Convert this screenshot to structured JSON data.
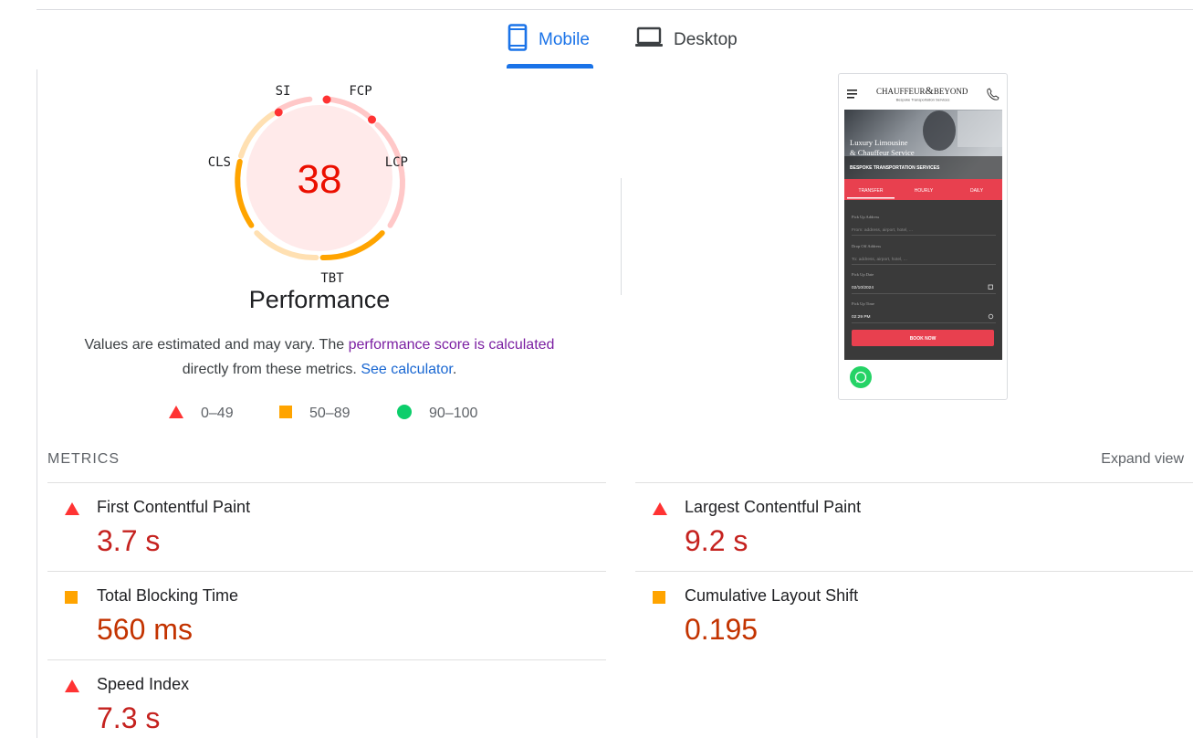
{
  "tabs": [
    {
      "label": "Mobile",
      "active": true
    },
    {
      "label": "Desktop",
      "active": false
    }
  ],
  "gauge": {
    "score": "38",
    "labels": {
      "si": "SI",
      "fcp": "FCP",
      "lcp": "LCP",
      "tbt": "TBT",
      "cls": "CLS"
    },
    "title": "Performance",
    "colors": {
      "fail": "#ff3333",
      "average": "#ffa400",
      "pass": "#0cce6b",
      "score_text": "#eb0f00",
      "fill": "#ffeaea"
    }
  },
  "description": {
    "part1": "Values are estimated and may vary. The ",
    "link1": "performance score is calculated",
    "part2": "directly from these metrics. ",
    "link2": "See calculator",
    "part3": "."
  },
  "legend": [
    {
      "range": "0–49",
      "icon": "triangle-icon"
    },
    {
      "range": "50–89",
      "icon": "square-icon"
    },
    {
      "range": "90–100",
      "icon": "circle-icon"
    }
  ],
  "screenshot": {
    "brand": "CHAUFFEUR",
    "brand_amp": "&",
    "brand2": "BEYOND",
    "tagline": "Bespoke Transportation Services",
    "hero_line1": "Luxury Limousine",
    "hero_line2": "& Chauffeur Service",
    "hero_sub": "BESPOKE TRANSPORTATION SERVICES",
    "tabs": [
      "TRANSFER",
      "HOURLY",
      "DAILY"
    ],
    "fields": [
      {
        "label": "Pick Up Address",
        "value": "From: address, airport, hotel, ..."
      },
      {
        "label": "Drop Off Address",
        "value": "To: address, airport, hotel, ..."
      },
      {
        "label": "Pick Up Date",
        "value": "02/10/2024"
      },
      {
        "label": "Pick Up Time",
        "value": "02:29 PM"
      }
    ],
    "button": "BOOK NOW"
  },
  "metrics": {
    "title": "METRICS",
    "expand": "Expand view",
    "items": [
      {
        "name": "First Contentful Paint",
        "value": "3.7 s",
        "rating": "fail"
      },
      {
        "name": "Largest Contentful Paint",
        "value": "9.2 s",
        "rating": "fail"
      },
      {
        "name": "Total Blocking Time",
        "value": "560 ms",
        "rating": "average"
      },
      {
        "name": "Cumulative Layout Shift",
        "value": "0.195",
        "rating": "average"
      },
      {
        "name": "Speed Index",
        "value": "7.3 s",
        "rating": "fail"
      }
    ]
  }
}
